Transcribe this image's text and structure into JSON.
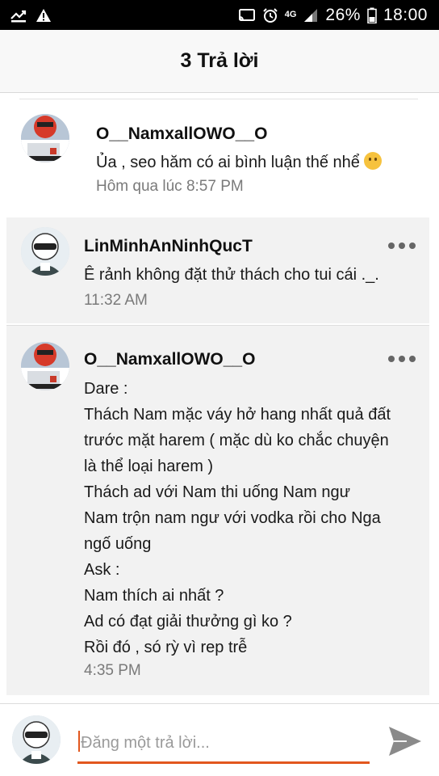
{
  "status_bar": {
    "network_type": "4G",
    "battery": "26%",
    "time": "18:00"
  },
  "header": {
    "title": "3 Trả lời"
  },
  "original_post": {
    "author": "O__NamxallOWO__O",
    "text": "Ủa , seo hăm có ai bình luận thế nhể",
    "emoji": "thinking-face",
    "time": "Hôm qua lúc 8:57 PM"
  },
  "replies": [
    {
      "author": "LinMinhAnNinhQucT",
      "lines": [
        "Ê rảnh không đặt thử thách cho tui cái ._."
      ],
      "time": "11:32 AM"
    },
    {
      "author": "O__NamxallOWO__O",
      "lines": [
        "Dare :",
        "Thách Nam mặc váy hở hang nhất quả đất",
        "trước mặt harem ( mặc dù ko chắc chuyện",
        "là thể loại harem )",
        "Thách ad với Nam thi uống Nam ngư",
        "Nam trộn nam ngư với vodka rồi cho Nga",
        "ngố uống",
        "Ask :",
        "Nam thích ai nhất ?",
        "Ad có đạt giải thưởng gì ko ?",
        "Rồi đó , só rỳ vì rep trễ"
      ],
      "time": "4:35 PM"
    }
  ],
  "composer": {
    "placeholder": "Đăng một trả lời..."
  },
  "colors": {
    "accent": "#e2571e",
    "reply_bg": "#f2f2f2",
    "header_bg": "#f8f8f8"
  }
}
